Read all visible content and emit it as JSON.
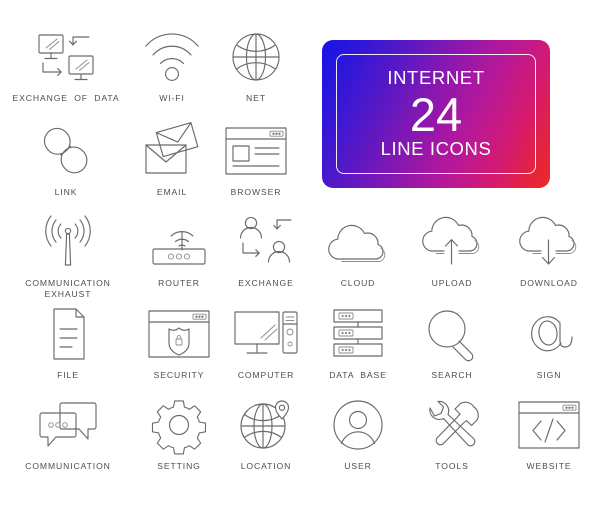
{
  "banner": {
    "top_text": "INTERNET",
    "number": "24",
    "bottom_text": "LINE ICONS",
    "gradient_start": "#1414e8",
    "gradient_mid": "#8e17ad",
    "gradient_end": "#ea2a24",
    "border_color": "#ffffff"
  },
  "style": {
    "background": "#ffffff",
    "stroke_color": "#6a6a6e",
    "label_color": "#4e4e50"
  },
  "rows": [
    {
      "id": "row-1",
      "cells": [
        {
          "icon": "exchange-of-data-icon",
          "label": "EXCHANGE  OF  DATA"
        },
        {
          "icon": "wifi-icon",
          "label": "WI-FI"
        },
        {
          "icon": "net-globe-icon",
          "label": "NET"
        }
      ]
    },
    {
      "id": "row-2",
      "cells": [
        {
          "icon": "link-chain-icon",
          "label": "LINK"
        },
        {
          "icon": "email-envelope-icon",
          "label": "EMAIL"
        },
        {
          "icon": "browser-window-icon",
          "label": "BROWSER"
        }
      ]
    },
    {
      "id": "row-3",
      "cells": [
        {
          "icon": "communication-tower-icon",
          "label": "COMMUNICATION\nEXHAUST"
        },
        {
          "icon": "router-icon",
          "label": "ROUTER"
        },
        {
          "icon": "exchange-users-icon",
          "label": "EXCHANGE"
        },
        {
          "icon": "cloud-icon",
          "label": "CLOUD"
        },
        {
          "icon": "cloud-upload-icon",
          "label": "UPLOAD"
        },
        {
          "icon": "cloud-download-icon",
          "label": "DOWNLOAD"
        }
      ]
    },
    {
      "id": "row-4",
      "cells": [
        {
          "icon": "file-document-icon",
          "label": "FILE"
        },
        {
          "icon": "security-shield-icon",
          "label": "SECURITY"
        },
        {
          "icon": "computer-desktop-icon",
          "label": "COMPUTER"
        },
        {
          "icon": "database-server-icon",
          "label": "DATA  BASE"
        },
        {
          "icon": "search-magnifier-icon",
          "label": "SEARCH"
        },
        {
          "icon": "at-sign-icon",
          "label": "SIGN"
        }
      ]
    },
    {
      "id": "row-5",
      "cells": [
        {
          "icon": "communication-chat-icon",
          "label": "COMMUNICATION"
        },
        {
          "icon": "setting-gear-icon",
          "label": "SETTING"
        },
        {
          "icon": "location-pin-globe-icon",
          "label": "LOCATION"
        },
        {
          "icon": "user-avatar-icon",
          "label": "USER"
        },
        {
          "icon": "tools-hammer-wrench-icon",
          "label": "TOOLS"
        },
        {
          "icon": "website-code-icon",
          "label": "WEBSITE"
        }
      ]
    }
  ]
}
